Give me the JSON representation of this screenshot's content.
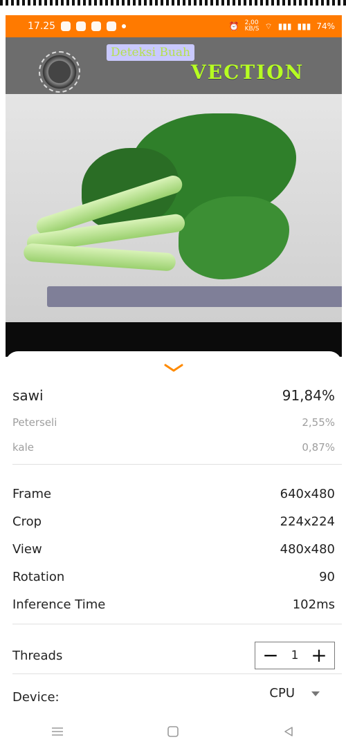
{
  "status_bar": {
    "time": "17.25",
    "net_speed_value": "2,00",
    "net_speed_unit": "KB/S",
    "battery": "74%"
  },
  "camera_overlay": {
    "chip_label": "Deteksi Buah",
    "brand": "VECTION"
  },
  "results": [
    {
      "label": "sawi",
      "score": "91,84%"
    },
    {
      "label": "Peterseli",
      "score": "2,55%"
    },
    {
      "label": "kale",
      "score": "0,87%"
    }
  ],
  "stats": {
    "frame": {
      "label": "Frame",
      "value": "640x480"
    },
    "crop": {
      "label": "Crop",
      "value": "224x224"
    },
    "view": {
      "label": "View",
      "value": "480x480"
    },
    "rotation": {
      "label": "Rotation",
      "value": "90"
    },
    "inference": {
      "label": "Inference Time",
      "value": "102ms"
    }
  },
  "threads": {
    "label": "Threads",
    "value": "1",
    "minus": "−",
    "plus": "+"
  },
  "device": {
    "label": "Device:",
    "value": "CPU"
  },
  "colors": {
    "accent": "#ff7a00",
    "brand_text": "#b7ff22"
  },
  "icons": {
    "collapse": "chevron-down-icon",
    "dropdown": "dropdown-arrow-icon",
    "nav_menu": "menu-icon",
    "nav_home": "home-square-icon",
    "nav_back": "back-triangle-icon"
  }
}
